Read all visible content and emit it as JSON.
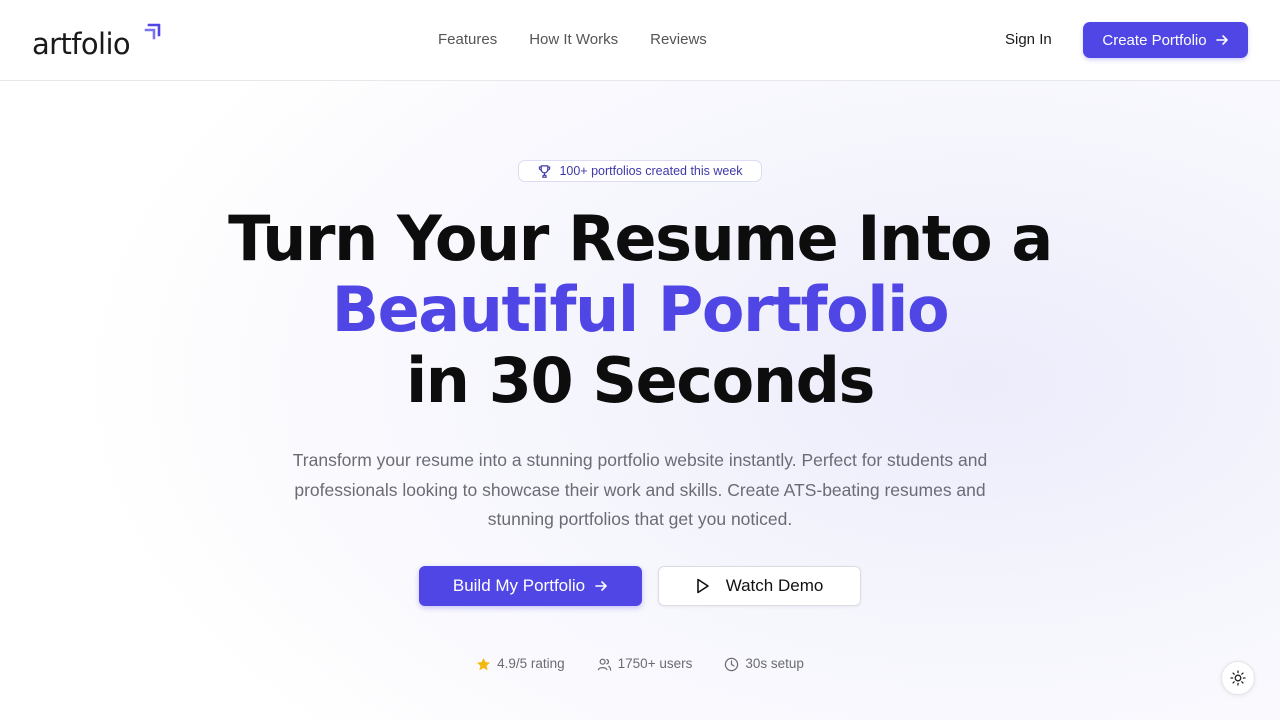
{
  "brand": {
    "name": "artfolio",
    "accent_color": "#4f46e5"
  },
  "nav": {
    "links": [
      "Features",
      "How It Works",
      "Reviews"
    ],
    "sign_in": "Sign In",
    "cta": "Create Portfolio"
  },
  "hero": {
    "badge": "100+ portfolios created this week",
    "headline_line1": "Turn Your Resume Into a",
    "headline_line2": "Beautiful Portfolio",
    "headline_line3": "in 30 Seconds",
    "subtext": "Transform your resume into a stunning portfolio website instantly. Perfect for students and professionals looking to showcase their work and skills. Create ATS-beating resumes and stunning portfolios that get you noticed.",
    "primary_button": "Build My Portfolio",
    "secondary_button": "Watch Demo"
  },
  "stats": {
    "rating": "4.9/5 rating",
    "users": "1750+ users",
    "setup": "30s setup"
  },
  "icons": {
    "badge": "trophy-icon",
    "rating": "star-icon",
    "users": "users-icon",
    "setup": "clock-icon",
    "theme": "sun-icon",
    "demo": "play-icon",
    "cta": "arrow-right-icon"
  }
}
